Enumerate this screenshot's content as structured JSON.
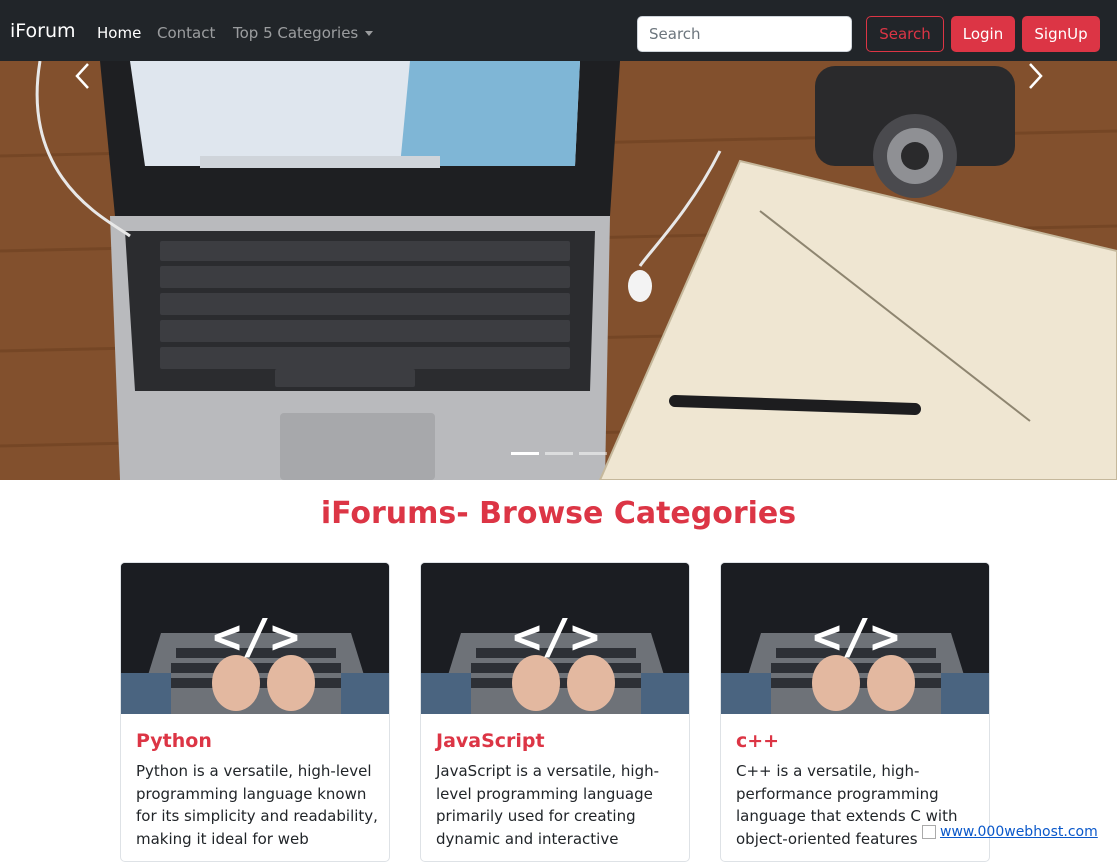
{
  "navbar": {
    "brand": "iForum",
    "links": [
      {
        "label": "Home",
        "active": true
      },
      {
        "label": "Contact",
        "active": false
      },
      {
        "label": "Top 5 Categories",
        "active": false,
        "dropdown": true
      }
    ],
    "search_placeholder": "Search",
    "search_button": "Search",
    "login_button": "Login",
    "signup_button": "SignUp"
  },
  "carousel": {
    "prev_icon": "chevron-left-icon",
    "next_icon": "chevron-right-icon",
    "slide_count": 3,
    "active_slide": 1
  },
  "section": {
    "heading": "iForums- Browse Categories"
  },
  "cards": [
    {
      "title": "Python",
      "text": "Python is a versatile, high-level programming language known for its simplicity and readability, making it ideal for web"
    },
    {
      "title": "JavaScript",
      "text": "JavaScript is a versatile, high-level programming language primarily used for creating dynamic and interactive"
    },
    {
      "title": "c++",
      "text": "C++ is a versatile, high-performance programming language that extends C with object-oriented features"
    }
  ],
  "watermark": {
    "text": "www.000webhost.com"
  },
  "colors": {
    "accent": "#dc3545",
    "navbar": "#212529",
    "link_muted": "rgba(255,255,255,.55)"
  }
}
